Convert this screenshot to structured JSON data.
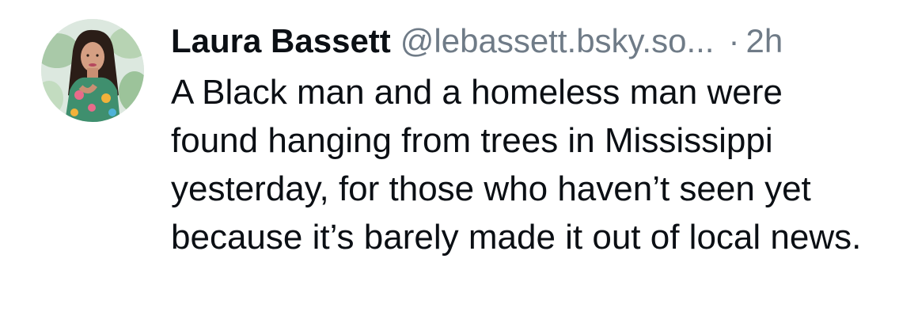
{
  "post": {
    "author_name": "Laura Bassett",
    "handle": "@lebassett.bsky.so...",
    "separator": "·",
    "time_ago": "2h",
    "text": "A Black man and a homeless man were found hanging from trees in Mississippi yesterday, for those who haven’t seen yet because it’s barely made it out of local news.",
    "avatar_icon": "profile-photo"
  },
  "colors": {
    "text_primary": "#0b0f14",
    "text_secondary": "#6f7b87",
    "background": "#ffffff"
  }
}
